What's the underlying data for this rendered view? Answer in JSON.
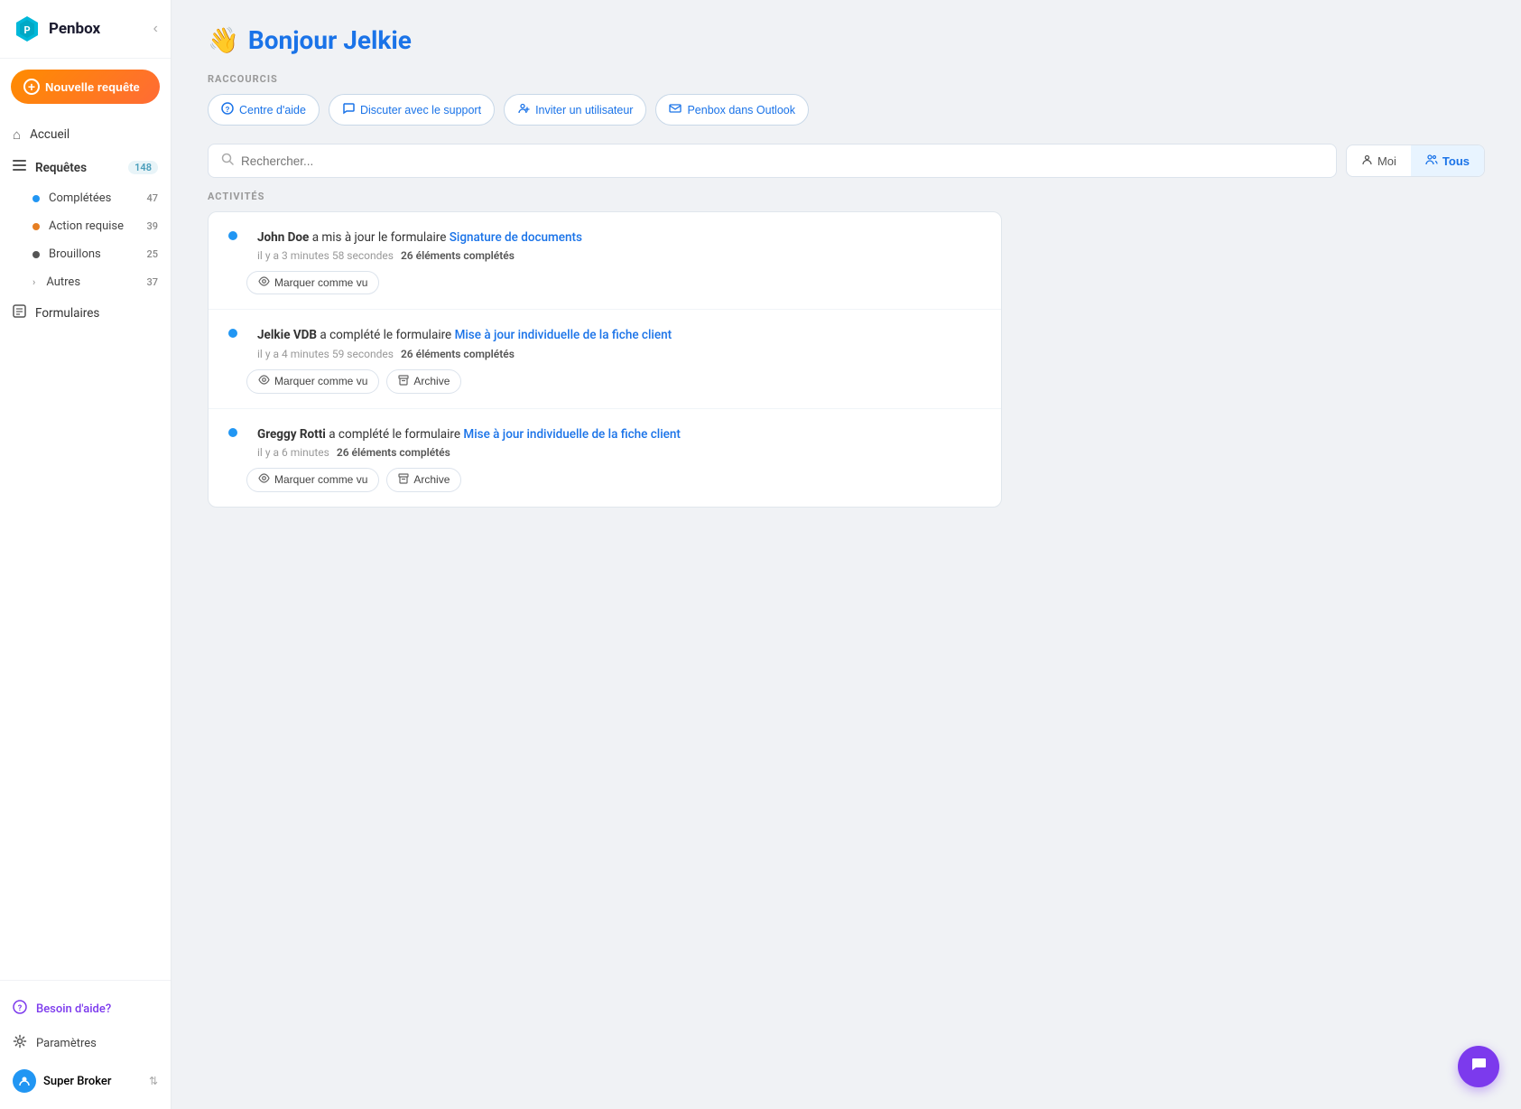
{
  "app": {
    "name": "Penbox",
    "collapse_btn": "‹"
  },
  "sidebar": {
    "new_request_label": "Nouvelle requête",
    "nav_items": [
      {
        "id": "accueil",
        "label": "Accueil",
        "icon": "⌂",
        "badge": null
      },
      {
        "id": "requetes",
        "label": "Requêtes",
        "icon": "≡",
        "badge": "148",
        "badge_type": "blue"
      }
    ],
    "sub_items": [
      {
        "id": "completees",
        "label": "Complétées",
        "dot_color": "blue",
        "badge": "47"
      },
      {
        "id": "action-requise",
        "label": "Action requise",
        "dot_color": "orange",
        "badge": "39"
      },
      {
        "id": "brouillons",
        "label": "Brouillons",
        "dot_color": "dark",
        "badge": "25"
      },
      {
        "id": "autres",
        "label": "Autres",
        "dot_color": "dark",
        "badge": "37",
        "has_chevron": true
      }
    ],
    "formulaires": {
      "label": "Formulaires",
      "icon": "📄"
    },
    "footer": {
      "help_label": "Besoin d'aide?",
      "settings_label": "Paramètres",
      "user_name": "Super Broker"
    }
  },
  "header": {
    "emoji": "👋",
    "greeting": "Bonjour Jelkie"
  },
  "shortcuts": {
    "label": "RACCOURCIS",
    "items": [
      {
        "id": "centre-aide",
        "icon": "?",
        "label": "Centre d'aide"
      },
      {
        "id": "discuter-support",
        "icon": "💬",
        "label": "Discuter avec le support"
      },
      {
        "id": "inviter-utilisateur",
        "icon": "👤",
        "label": "Inviter un utilisateur"
      },
      {
        "id": "penbox-outlook",
        "icon": "✉",
        "label": "Penbox dans Outlook"
      }
    ]
  },
  "search": {
    "placeholder": "Rechercher..."
  },
  "filter_tabs": {
    "items": [
      {
        "id": "moi",
        "label": "Moi",
        "icon": "👤",
        "active": false
      },
      {
        "id": "tous",
        "label": "Tous",
        "icon": "👥",
        "active": true
      }
    ]
  },
  "activities": {
    "label": "ACTIVITÉS",
    "items": [
      {
        "id": "activity-1",
        "user": "John Doe",
        "action": "a mis à jour le formulaire",
        "form_name": "Signature de documents",
        "time": "il y a 3 minutes 58 secondes",
        "count_label": "26 éléments complétés",
        "buttons": [
          {
            "id": "mark-seen-1",
            "icon": "👁",
            "label": "Marquer comme vu"
          }
        ]
      },
      {
        "id": "activity-2",
        "user": "Jelkie VDB",
        "action": "a complété le formulaire",
        "form_name": "Mise à jour individuelle de la fiche client",
        "time": "il y a 4 minutes 59 secondes",
        "count_label": "26 éléments complétés",
        "buttons": [
          {
            "id": "mark-seen-2",
            "icon": "👁",
            "label": "Marquer comme vu"
          },
          {
            "id": "archive-2",
            "icon": "📁",
            "label": "Archive"
          }
        ]
      },
      {
        "id": "activity-3",
        "user": "Greggy Rotti",
        "action": "a complété le formulaire",
        "form_name": "Mise à jour individuelle de la fiche client",
        "time": "il y a 6 minutes",
        "count_label": "26 éléments complétés",
        "buttons": [
          {
            "id": "mark-seen-3",
            "icon": "👁",
            "label": "Marquer comme vu"
          },
          {
            "id": "archive-3",
            "icon": "📁",
            "label": "Archive"
          }
        ]
      }
    ]
  }
}
